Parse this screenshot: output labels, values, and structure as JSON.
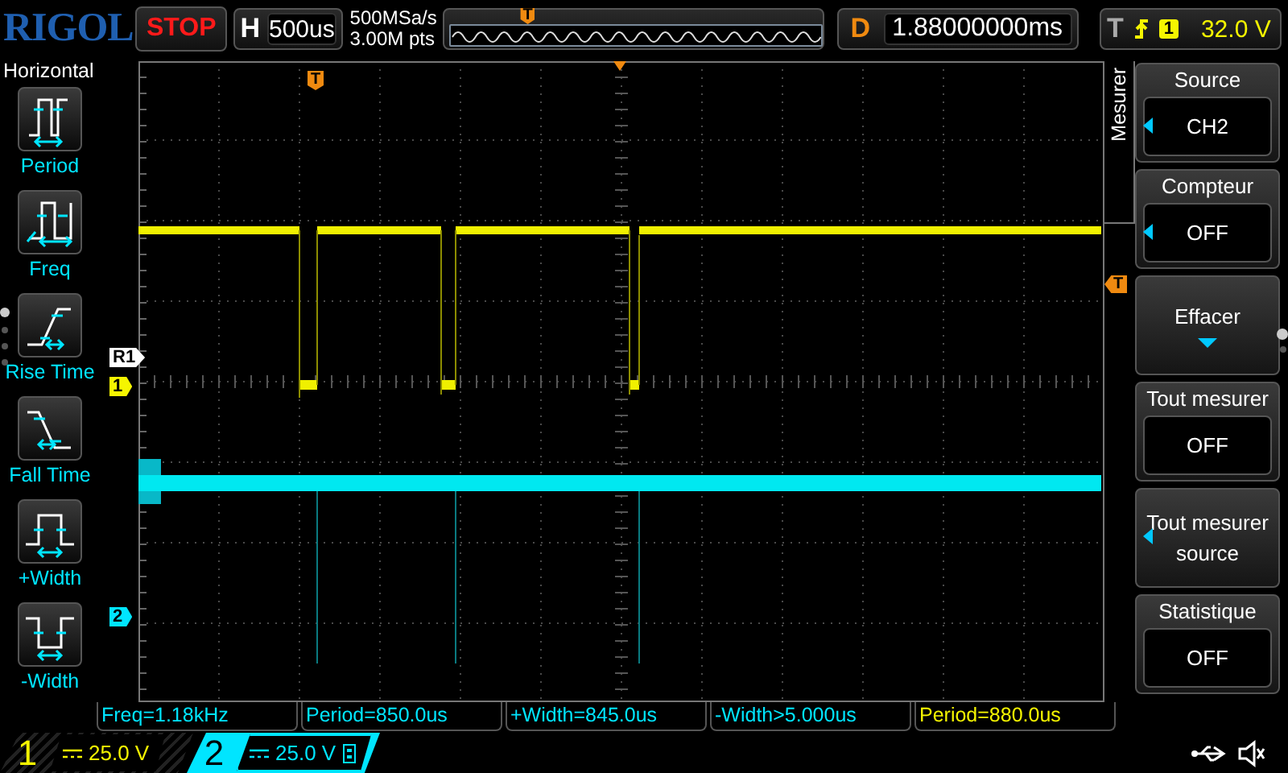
{
  "top_bar": {
    "logo": "RIGOL",
    "run_state": "STOP",
    "timebase": {
      "label": "H",
      "value": "500us"
    },
    "sample_rate": "500MSa/s",
    "memory_depth": "3.00M pts",
    "trigger_position": {
      "marker": "T"
    },
    "delay": {
      "label": "D",
      "value": "1.88000000ms"
    },
    "trigger": {
      "label": "T",
      "channel": "1",
      "level": "32.0 V"
    }
  },
  "left_menu": {
    "title": "Horizontal",
    "items": [
      {
        "label": "Period",
        "kind": "period"
      },
      {
        "label": "Freq",
        "kind": "freq"
      },
      {
        "label": "Rise Time",
        "kind": "rise"
      },
      {
        "label": "Fall Time",
        "kind": "fall"
      },
      {
        "label": "+Width",
        "kind": "pwidth"
      },
      {
        "label": "-Width",
        "kind": "nwidth"
      }
    ],
    "pages": [
      {
        "selected": true
      },
      {
        "selected": false
      },
      {
        "selected": false
      },
      {
        "selected": false
      }
    ]
  },
  "screen": {
    "markers": [
      {
        "label": "R1",
        "kind": "reference"
      },
      {
        "label": "1",
        "kind": "channel1"
      },
      {
        "label": "2",
        "kind": "channel2"
      }
    ],
    "trigger_position_marker": "T",
    "trigger_level_marker": "T"
  },
  "right_menu": {
    "title": "Mesurer",
    "items": [
      {
        "label": "Source",
        "value": "CH2",
        "kind": "select"
      },
      {
        "label": "Compteur",
        "value": "OFF",
        "kind": "select"
      },
      {
        "label": "Effacer",
        "kind": "submenu"
      },
      {
        "label": "Tout mesurer",
        "value": "OFF",
        "kind": "toggle"
      },
      {
        "label": "Tout mesurer",
        "value": "source",
        "kind": "multi"
      },
      {
        "label": "Statistique",
        "value": "OFF",
        "kind": "toggle"
      }
    ],
    "pages": [
      {
        "selected": true
      },
      {
        "selected": false
      }
    ]
  },
  "measurements": [
    {
      "text": "Freq=1.18kHz",
      "color": "#00e5ff"
    },
    {
      "text": "Period=850.0us",
      "color": "#00e5ff"
    },
    {
      "text": "+Width=845.0us",
      "color": "#00e5ff"
    },
    {
      "text": "-Width>5.000us",
      "color": "#00e5ff"
    },
    {
      "text": "Period=880.0us",
      "color": "#f5f500"
    }
  ],
  "channels": [
    {
      "number": "1",
      "scale": "25.0 V",
      "selected": false,
      "color": "#f5f500",
      "bw_limit": false
    },
    {
      "number": "2",
      "scale": "25.0 V",
      "selected": true,
      "color": "#00e5ff",
      "bw_limit": true
    }
  ]
}
